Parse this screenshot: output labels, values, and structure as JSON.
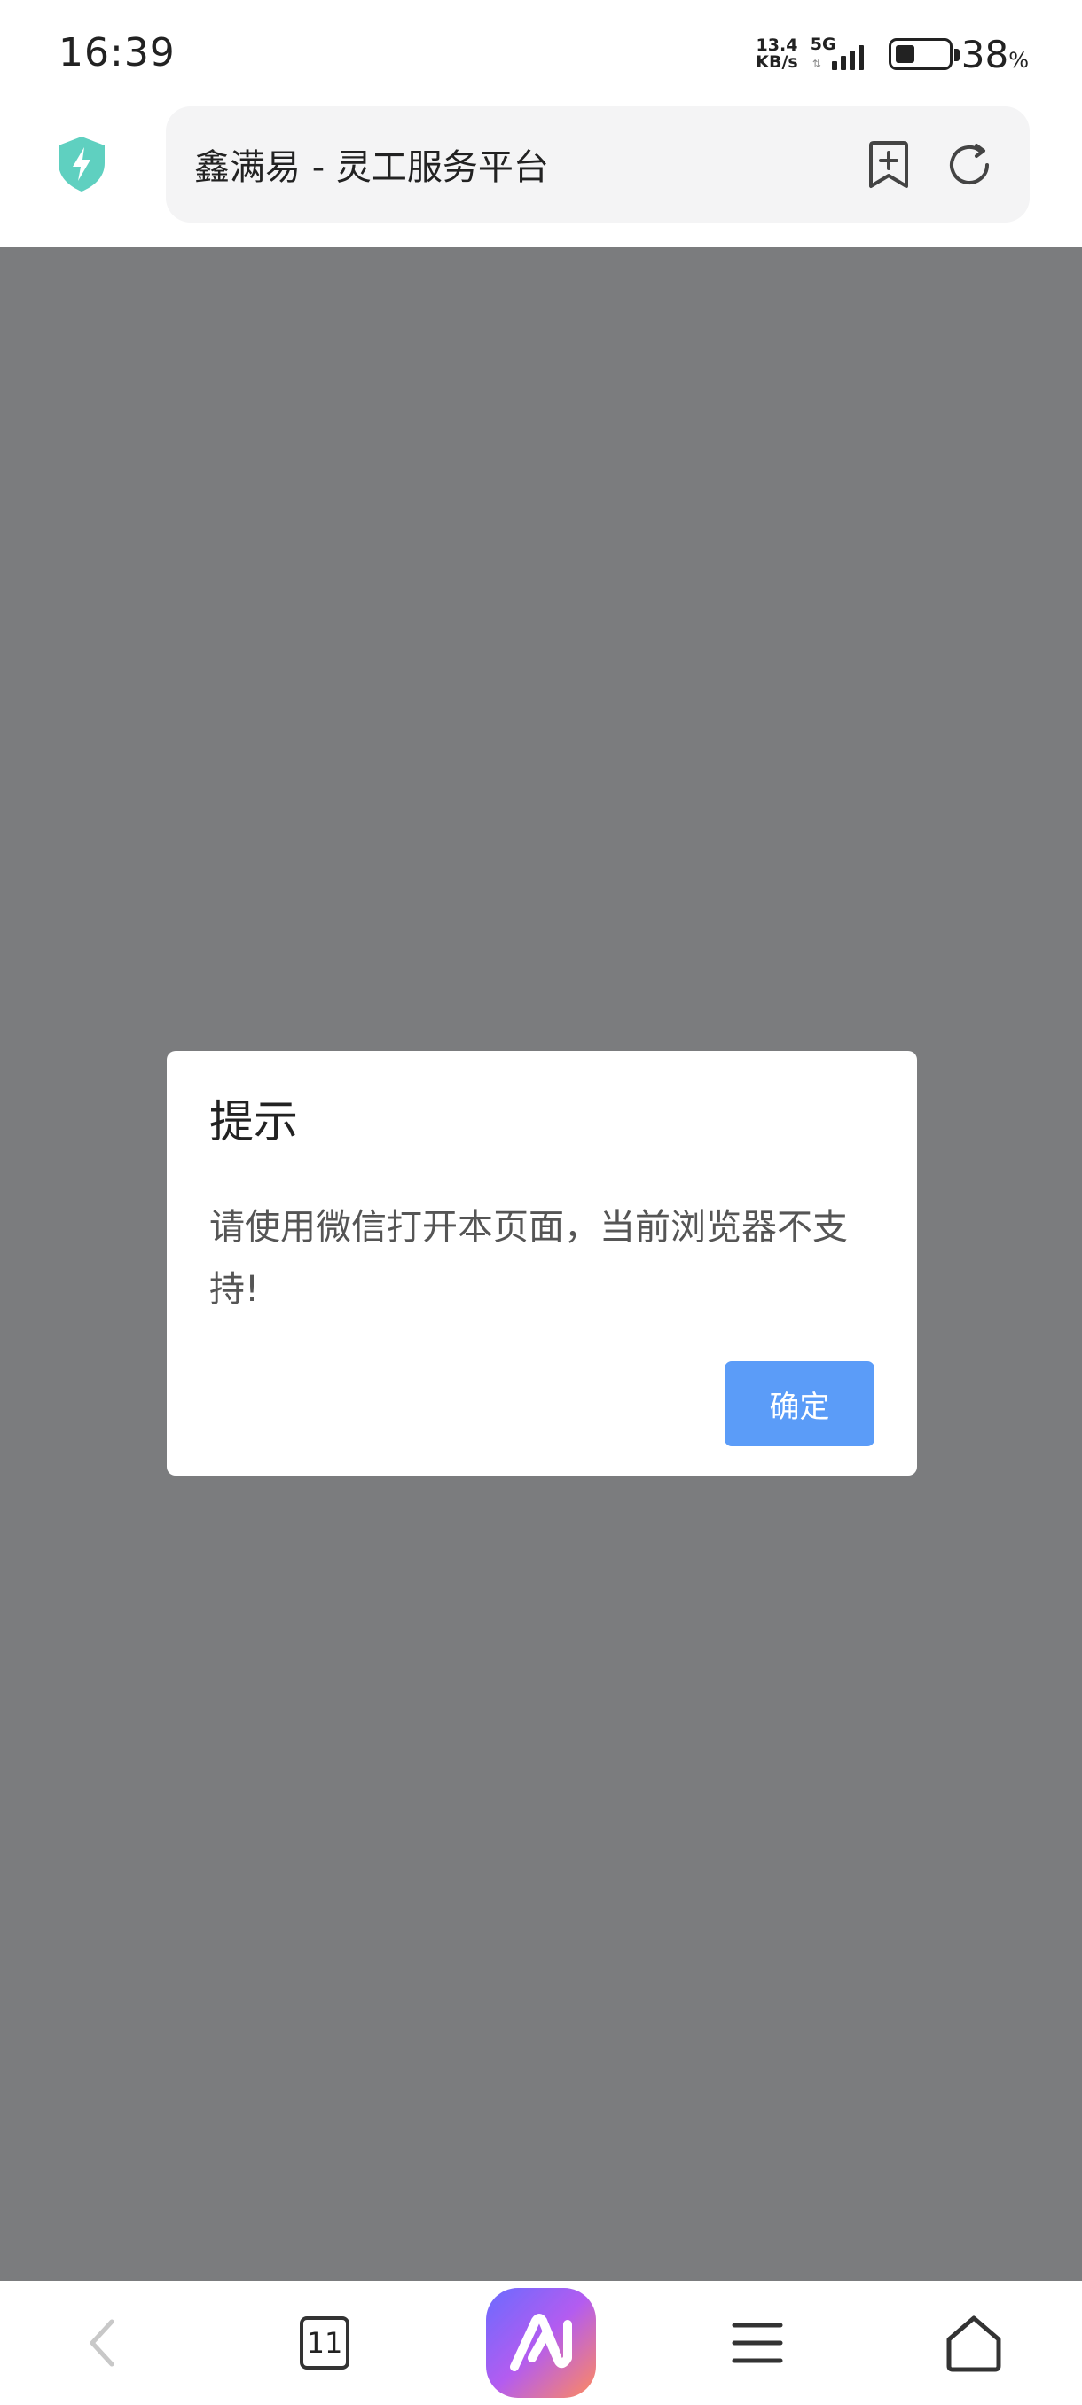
{
  "status_bar": {
    "time": "16:39",
    "net_speed_value": "13.4",
    "net_speed_unit": "KB/s",
    "network": "5G",
    "battery_percent": "38",
    "battery_unit": "%",
    "battery_level": 0.38
  },
  "address_bar": {
    "page_title": "鑫满易 - 灵工服务平台",
    "security_icon": "shield-bolt-icon",
    "bookmark_icon": "bookmark-add-icon",
    "reload_icon": "reload-icon"
  },
  "dialog": {
    "title": "提示",
    "message": "请使用微信打开本页面，当前浏览器不支持!",
    "confirm_label": "确定"
  },
  "bottom_nav": {
    "tab_count": "11",
    "icons": [
      "back-icon",
      "tabs-icon",
      "ai-assistant-icon",
      "menu-icon",
      "home-icon"
    ]
  },
  "colors": {
    "overlay": "#7b7c7e",
    "confirm_button": "#5b9cf8",
    "shield": "#5fd0c0"
  }
}
